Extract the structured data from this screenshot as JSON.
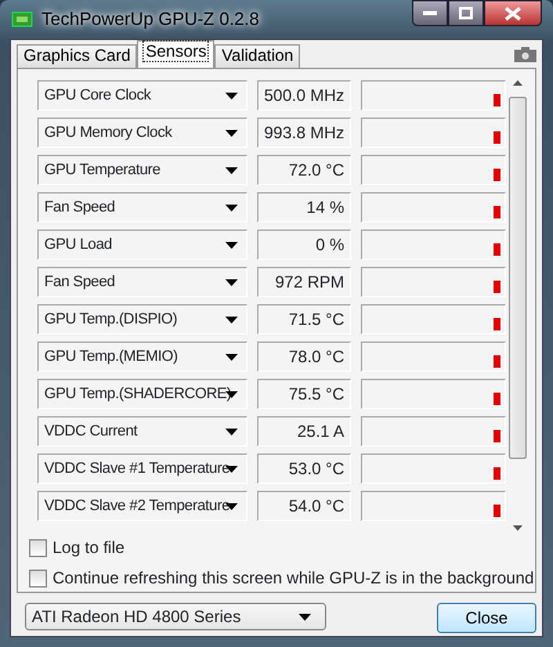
{
  "window": {
    "title": "TechPowerUp GPU-Z 0.2.8"
  },
  "tabs": [
    {
      "label": "Graphics Card",
      "selected": false
    },
    {
      "label": "Sensors",
      "selected": true
    },
    {
      "label": "Validation",
      "selected": false
    }
  ],
  "sensors": [
    {
      "name": "GPU Core Clock",
      "value": "500.0 MHz"
    },
    {
      "name": "GPU Memory Clock",
      "value": "993.8 MHz"
    },
    {
      "name": "GPU Temperature",
      "value": "72.0 °C"
    },
    {
      "name": "Fan Speed",
      "value": "14 %"
    },
    {
      "name": "GPU Load",
      "value": "0 %"
    },
    {
      "name": "Fan Speed",
      "value": "972 RPM"
    },
    {
      "name": "GPU Temp.(DISPIO)",
      "value": "71.5 °C"
    },
    {
      "name": "GPU Temp.(MEMIO)",
      "value": "78.0 °C"
    },
    {
      "name": "GPU Temp.(SHADERCORE)",
      "value": "75.5 °C"
    },
    {
      "name": "VDDC Current",
      "value": "25.1 A"
    },
    {
      "name": "VDDC Slave #1 Temperature",
      "value": "53.0 °C"
    },
    {
      "name": "VDDC Slave #2 Temperature",
      "value": "54.0 °C"
    }
  ],
  "options": [
    {
      "label": "Log to file",
      "checked": false
    },
    {
      "label": "Continue refreshing this screen while GPU-Z is in the background",
      "checked": false
    }
  ],
  "card_select": {
    "value": "ATI Radeon HD 4800 Series"
  },
  "buttons": [
    {
      "label": "Close"
    }
  ]
}
